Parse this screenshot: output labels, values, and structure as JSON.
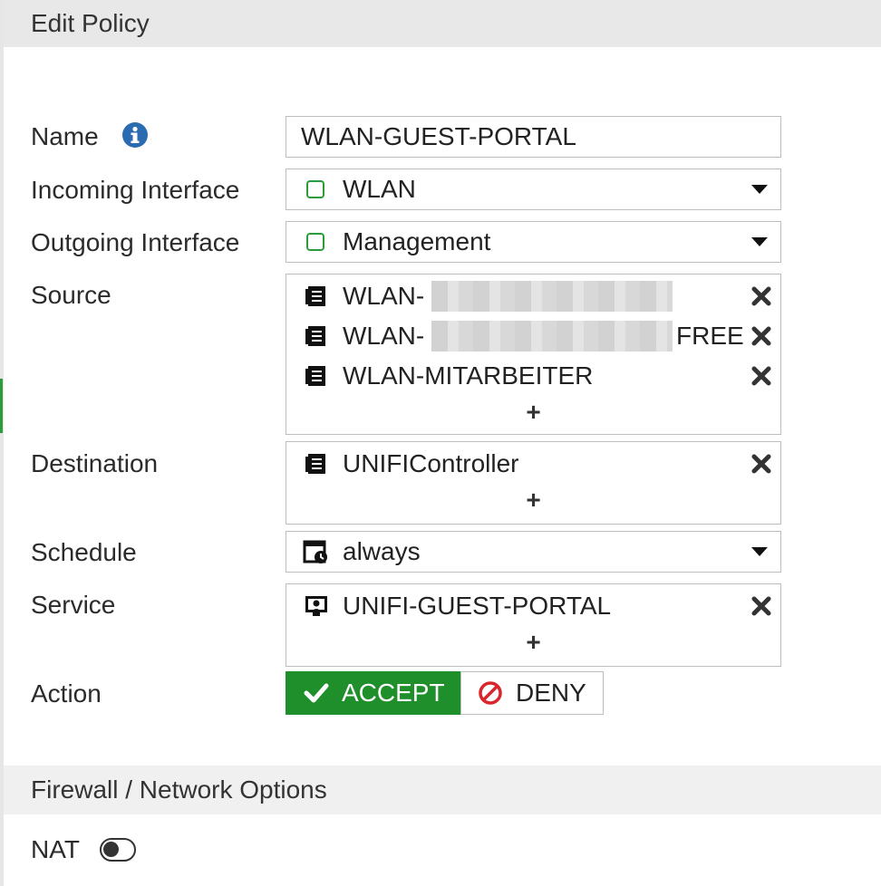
{
  "header": {
    "title": "Edit Policy"
  },
  "fields": {
    "name": {
      "label": "Name",
      "value": "WLAN-GUEST-PORTAL"
    },
    "incoming": {
      "label": "Incoming Interface",
      "value": "WLAN"
    },
    "outgoing": {
      "label": "Outgoing Interface",
      "value": "Management"
    },
    "source": {
      "label": "Source",
      "items": [
        "WLAN-",
        "WLAN-",
        "WLAN-MITARBEITER"
      ],
      "item2_suffix": "FREE",
      "add": "+"
    },
    "destination": {
      "label": "Destination",
      "items": [
        "UNIFIController"
      ],
      "add": "+"
    },
    "schedule": {
      "label": "Schedule",
      "value": "always"
    },
    "service": {
      "label": "Service",
      "items": [
        "UNIFI-GUEST-PORTAL"
      ],
      "add": "+"
    },
    "action": {
      "label": "Action",
      "accept": "ACCEPT",
      "deny": "DENY",
      "selected": "ACCEPT"
    }
  },
  "firewall": {
    "title": "Firewall / Network Options",
    "nat_label": "NAT",
    "nat_enabled": false
  },
  "colors": {
    "accept": "#1f8f2b",
    "interface_icon": "#2a9d3a",
    "deny_icon": "#d9262c",
    "info_icon": "#2b6cb0"
  }
}
